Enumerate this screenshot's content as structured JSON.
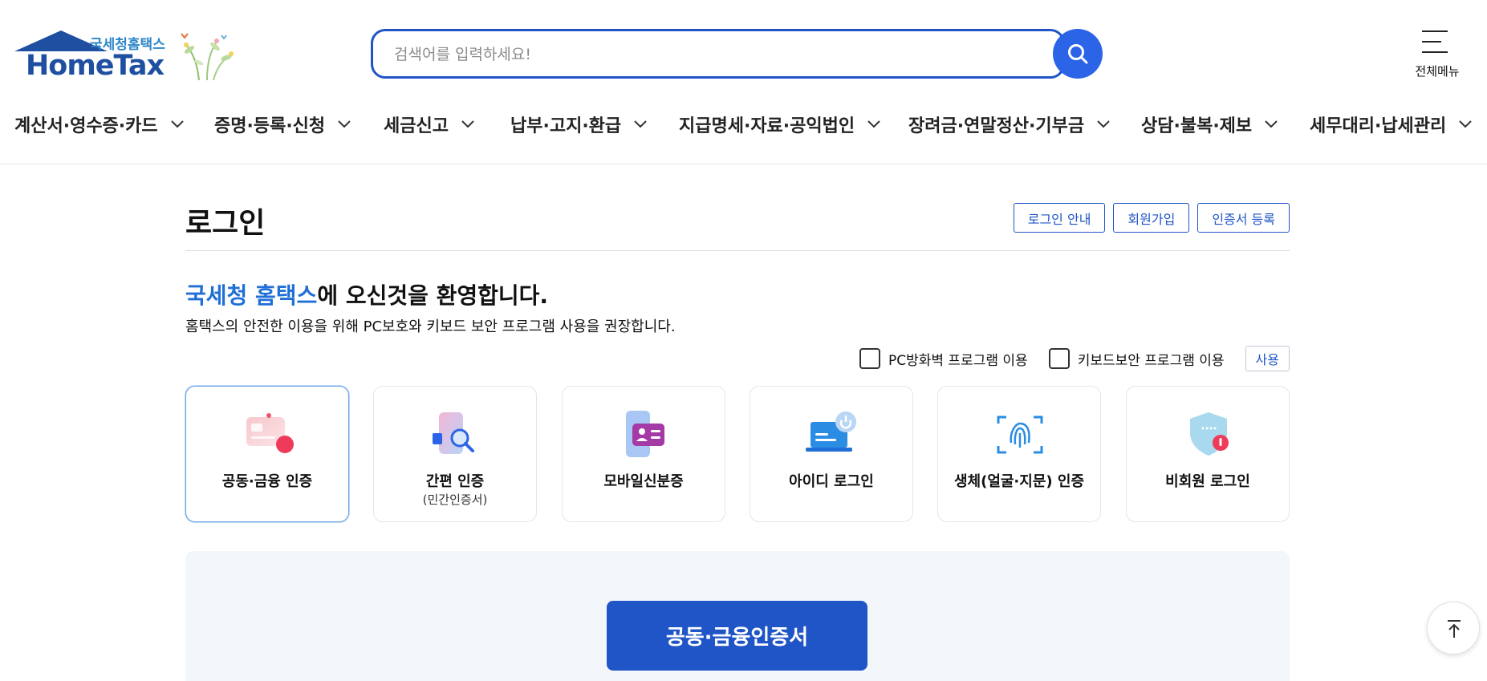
{
  "brand": {
    "sub": "국세청홈택스",
    "main": "HomeTax",
    "primary_color": "#1f55c6",
    "accent_color": "#1f6fd6"
  },
  "search": {
    "placeholder": "검색어를 입력하세요!",
    "value": "",
    "icon": "search-icon"
  },
  "all_menu": {
    "label": "전체메뉴",
    "icon": "hamburger-icon"
  },
  "gnb": {
    "items": [
      {
        "label": "계산서·영수증·카드"
      },
      {
        "label": "증명·등록·신청"
      },
      {
        "label": "세금신고"
      },
      {
        "label": "납부·고지·환급"
      },
      {
        "label": "지급명세·자료·공익법인"
      },
      {
        "label": "장려금·연말정산·기부금"
      },
      {
        "label": "상담·불복·제보"
      },
      {
        "label": "세무대리·납세관리"
      }
    ]
  },
  "page": {
    "title": "로그인",
    "buttons": {
      "login_guide": "로그인 안내",
      "signup": "회원가입",
      "cert_register": "인증서 등록"
    }
  },
  "welcome": {
    "accent": "국세청 홈택스",
    "rest": "에 오신것을 환영합니다.",
    "notice": "홈택스의 안전한 이용을 위해 PC보호와 키보드 보안 프로그램 사용을 권장합니다."
  },
  "options": {
    "firewall": {
      "label": "PC방화벽 프로그램 이용",
      "checked": false
    },
    "keyboard": {
      "label": "키보드보안 프로그램 이용",
      "checked": false
    },
    "use_button": "사용"
  },
  "login_methods": [
    {
      "label": "공동·금융 인증",
      "sub": "",
      "icon": "certificate-card-icon",
      "active": true
    },
    {
      "label": "간편 인증",
      "sub": "(민간인증서)",
      "icon": "simple-auth-icon",
      "active": false
    },
    {
      "label": "모바일신분증",
      "sub": "",
      "icon": "mobile-id-icon",
      "active": false
    },
    {
      "label": "아이디 로그인",
      "sub": "",
      "icon": "laptop-power-icon",
      "active": false
    },
    {
      "label": "생체(얼굴·지문) 인증",
      "sub": "",
      "icon": "fingerprint-icon",
      "active": false
    },
    {
      "label": "비회원 로그인",
      "sub": "",
      "icon": "shield-icon",
      "active": false
    }
  ],
  "panel": {
    "primary_button": "공동·금융인증서"
  },
  "scroll_top": {
    "icon": "arrow-up-icon"
  }
}
